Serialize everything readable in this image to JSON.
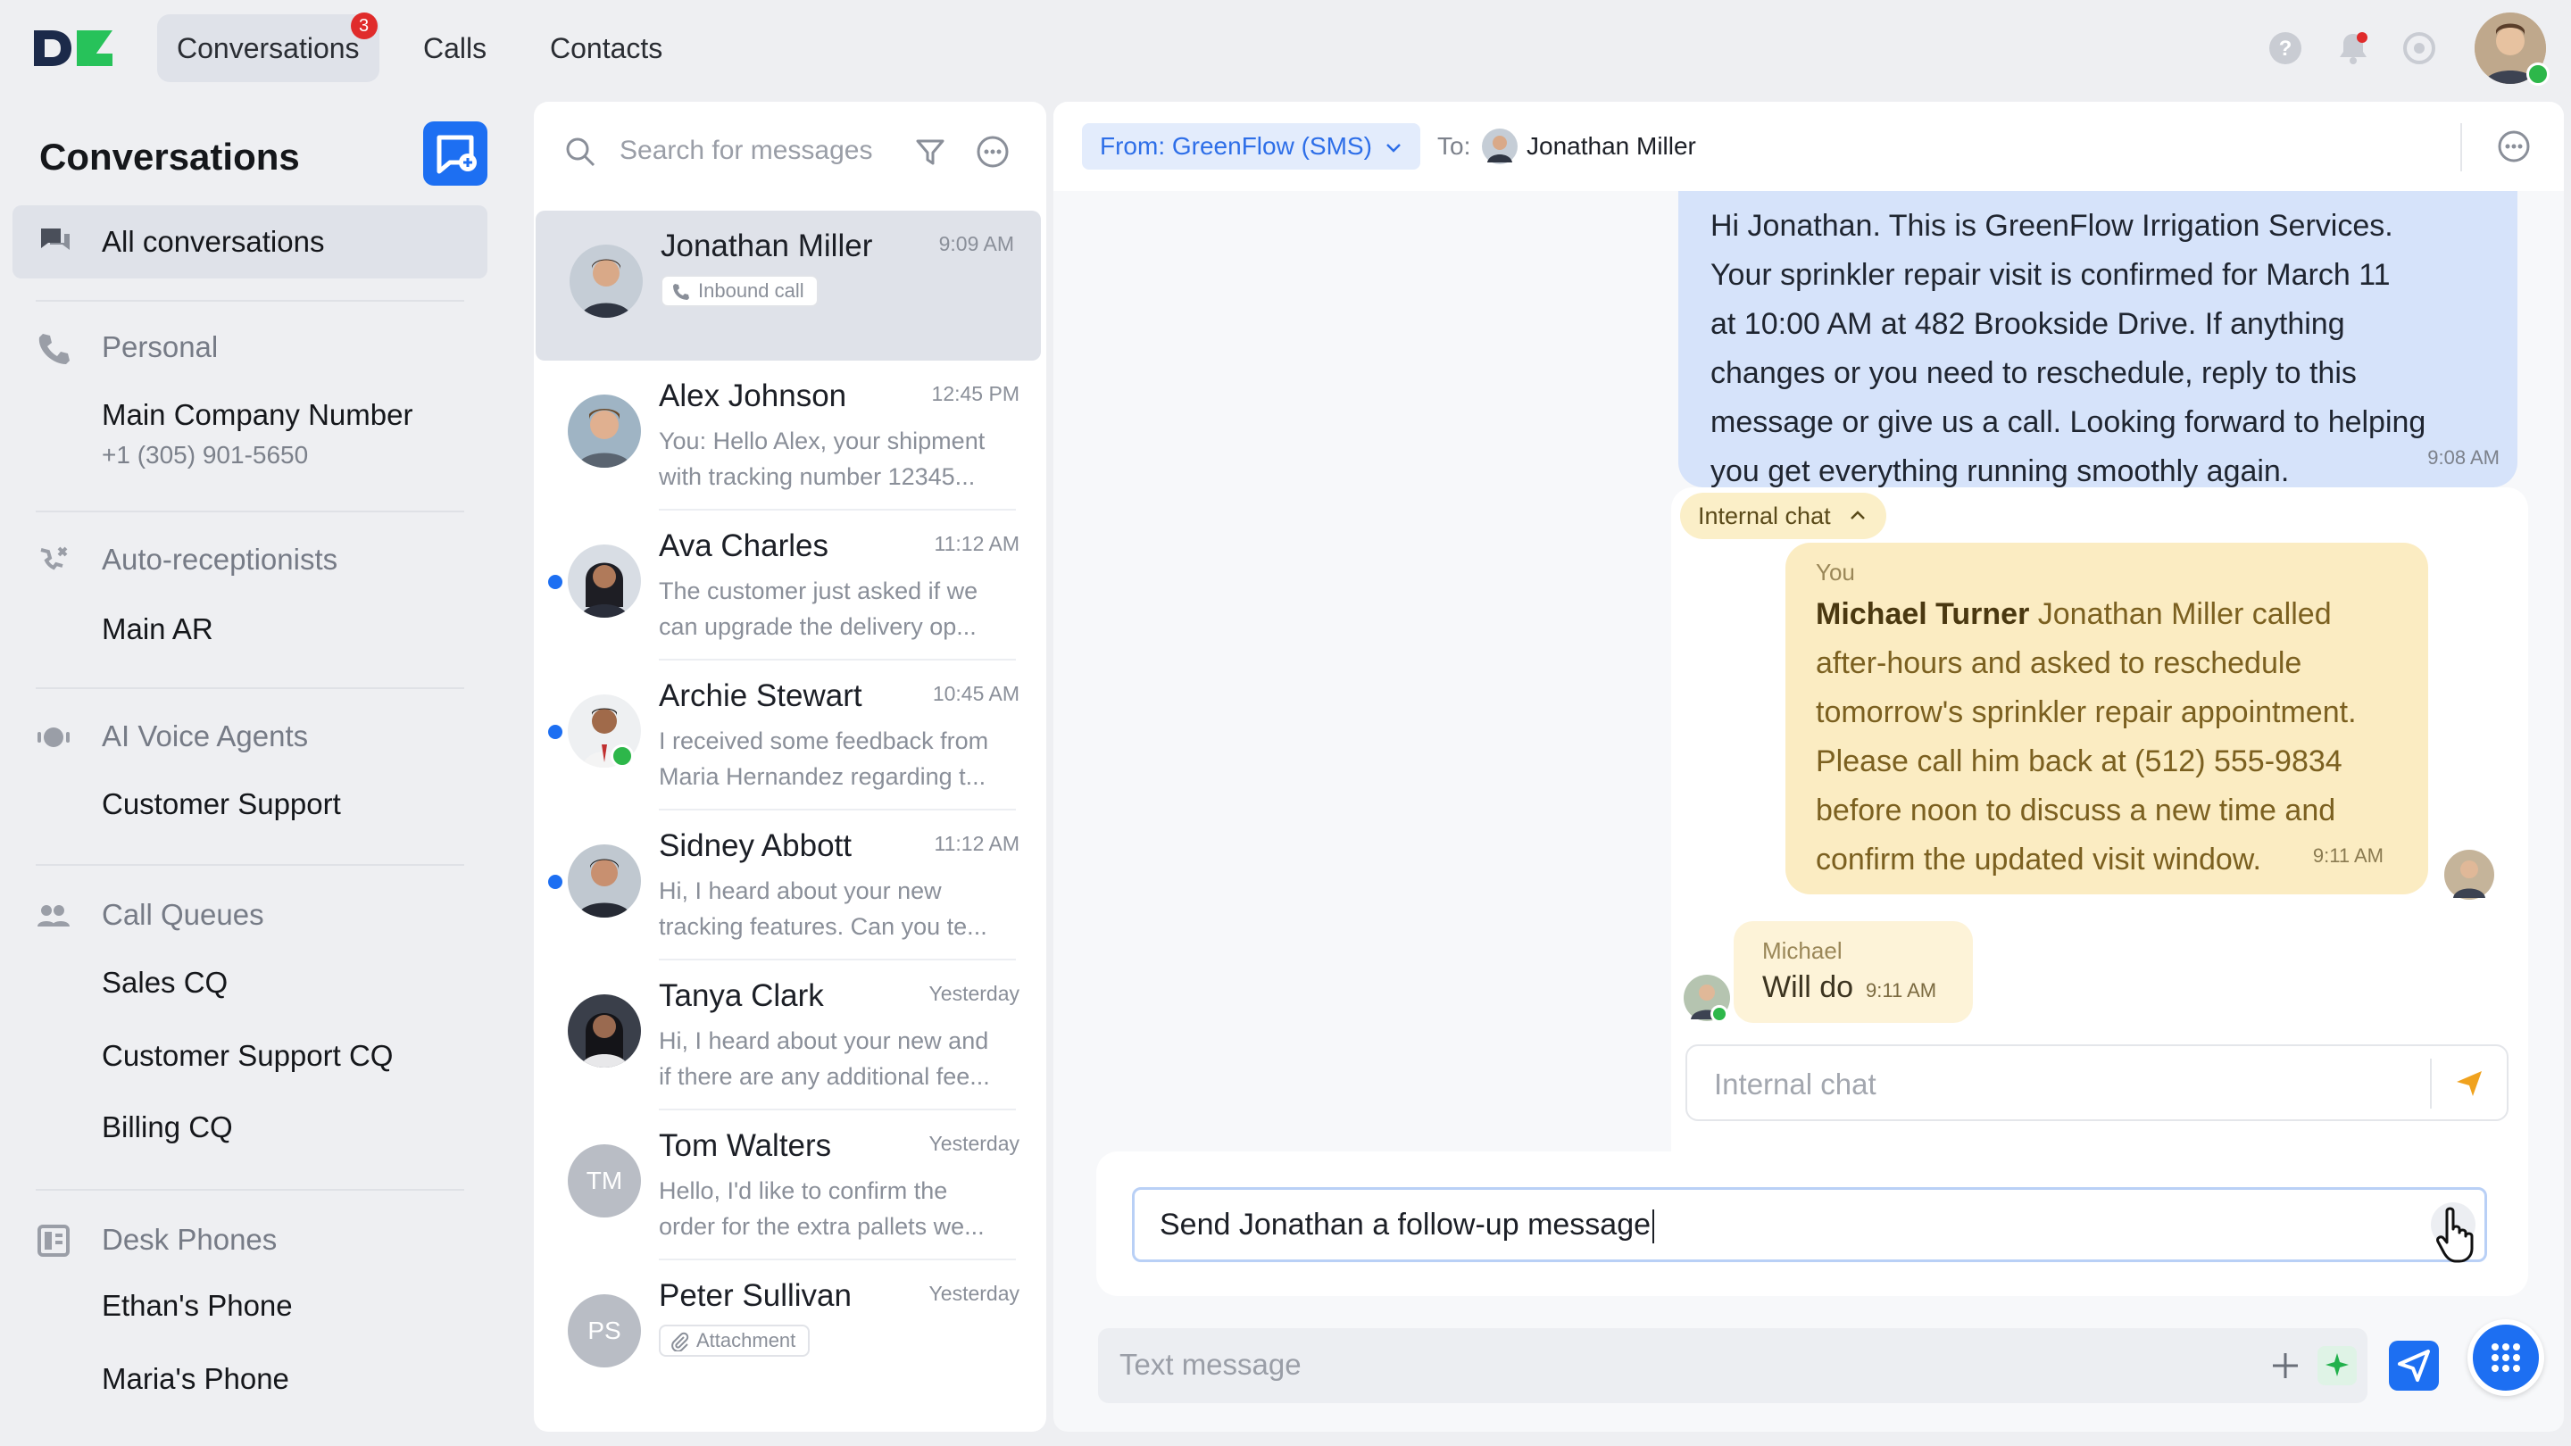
{
  "app": {
    "logo": "DC"
  },
  "nav": {
    "tabs": [
      {
        "label": "Conversations",
        "badge": "3",
        "active": true
      },
      {
        "label": "Calls"
      },
      {
        "label": "Contacts"
      }
    ],
    "icons": [
      "help-icon",
      "notification-bell-icon",
      "settings-icon"
    ]
  },
  "sidebar": {
    "title": "Conversations",
    "all_label": "All conversations",
    "sections": [
      {
        "heading": "Personal",
        "icon": "phone-icon",
        "items": [
          {
            "label": "Main Company Number",
            "sub": "+1 (305) 901-5650"
          }
        ]
      },
      {
        "heading": "Auto-receptionists",
        "icon": "auto-receptionist-icon",
        "items": [
          {
            "label": "Main AR"
          }
        ]
      },
      {
        "heading": "AI Voice Agents",
        "icon": "ai-agent-icon",
        "items": [
          {
            "label": "Customer Support"
          }
        ]
      },
      {
        "heading": "Call Queues",
        "icon": "queue-icon",
        "items": [
          {
            "label": "Sales CQ"
          },
          {
            "label": "Customer Support CQ"
          },
          {
            "label": "Billing CQ"
          }
        ]
      },
      {
        "heading": "Desk Phones",
        "icon": "desk-phone-icon",
        "items": [
          {
            "label": "Ethan's Phone"
          },
          {
            "label": "Maria's Phone"
          }
        ]
      }
    ]
  },
  "list": {
    "search_placeholder": "Search for messages",
    "conversations": [
      {
        "name": "Jonathan Miller",
        "time": "9:09 AM",
        "chip": "Inbound call",
        "active": true
      },
      {
        "name": "Alex Johnson",
        "time": "12:45 PM",
        "preview1": "You: Hello Alex, your shipment",
        "preview2": "with tracking number 12345..."
      },
      {
        "name": "Ava Charles",
        "time": "11:12 AM",
        "preview1": "The customer just asked if we",
        "preview2": "can upgrade the delivery op...",
        "unread": true
      },
      {
        "name": "Archie Stewart",
        "time": "10:45 AM",
        "preview1": "I received some feedback from",
        "preview2": "Maria Hernandez regarding t...",
        "unread": true
      },
      {
        "name": "Sidney Abbott",
        "time": "11:12 AM",
        "preview1": "Hi, I heard about your new",
        "preview2": "tracking features. Can you te...",
        "unread": true
      },
      {
        "name": "Tanya Clark",
        "time": "Yesterday",
        "preview1": "Hi, I heard about your new and",
        "preview2": "if there are any additional fee..."
      },
      {
        "name": "Tom Walters",
        "time": "Yesterday",
        "initials": "TM",
        "preview1": "Hello, I'd like to confirm the",
        "preview2": "order for the extra pallets we..."
      },
      {
        "name": "Peter Sullivan",
        "time": "Yesterday",
        "initials": "PS",
        "chip": "Attachment"
      }
    ]
  },
  "chat": {
    "from_label": "From: GreenFlow (SMS)",
    "to_label": "To:",
    "to_name": "Jonathan Miller",
    "sms_lines": [
      "Hi Jonathan. This is GreenFlow Irrigation Services.",
      "Your sprinkler repair visit is confirmed for March 11",
      "at 10:00 AM at 482 Brookside Drive. If anything",
      "changes or you need to reschedule, reply to this",
      "message or give us a call. Looking forward to helping",
      "you get everything running smoothly again."
    ],
    "sms_time": "9:08 AM",
    "internal_tag": "Internal chat",
    "note": {
      "author": "You",
      "mention": "Michael Turner",
      "first_line_rest": " Jonathan Miller called",
      "lines": [
        "after-hours and asked to reschedule",
        "tomorrow's sprinkler repair appointment.",
        "Please call him back at (512) 555-9834",
        "before noon to discuss a new time and",
        "confirm the updated visit window."
      ],
      "time": "9:11 AM"
    },
    "reply": {
      "author": "Michael",
      "text": "Will do",
      "time": "9:11 AM"
    },
    "internal_placeholder": "Internal chat",
    "prompt_text": "Send Jonathan  a follow-up message",
    "compose_placeholder": "Text message"
  },
  "colors": {
    "accent": "#1d6ff2",
    "sms_bubble": "#d6e3fa",
    "note_bubble": "#fbecc2",
    "unread": "#1d6ff2",
    "badge": "#e02b2b"
  }
}
